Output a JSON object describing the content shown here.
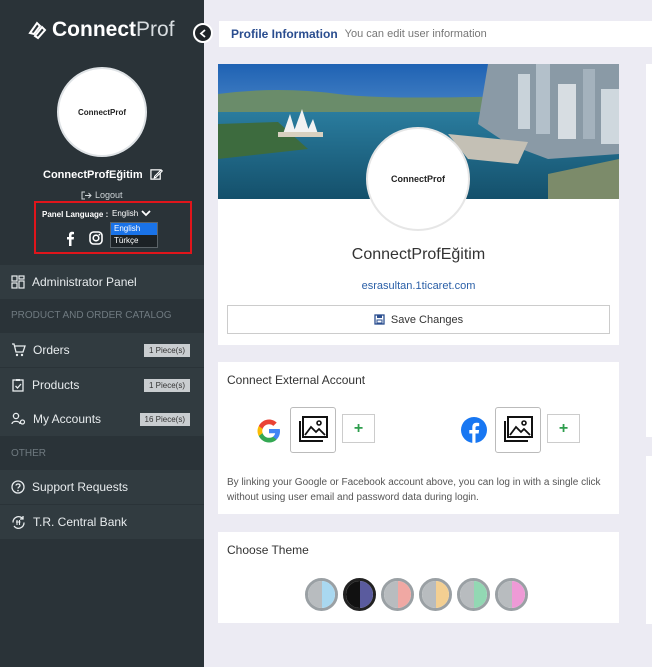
{
  "sidebar": {
    "brand_bold": "Connect",
    "brand_thin": "Prof",
    "avatar_text": "ConnectProf",
    "user_name": "ConnectProfEğitim",
    "logout": "Logout",
    "language_label": "Panel Language :",
    "language_current": "English",
    "language_options": [
      "English",
      "Türkçe"
    ],
    "nav": {
      "admin_panel": "Administrator Panel",
      "section_catalog": "PRODUCT AND ORDER CATALOG",
      "orders": "Orders",
      "orders_badge": "1 Piece(s)",
      "products": "Products",
      "products_badge": "1 Piece(s)",
      "accounts": "My Accounts",
      "accounts_badge": "16 Piece(s)",
      "section_other": "OTHER",
      "support": "Support Requests",
      "central_bank": "T.R. Central Bank"
    }
  },
  "header": {
    "title": "Profile Information",
    "subtitle": "You can edit user information"
  },
  "profile": {
    "avatar_text": "ConnectProf",
    "name": "ConnectProfEğitim",
    "email": "esrasultan.1ticaret.com",
    "save_label": "Save Changes"
  },
  "external": {
    "title": "Connect External Account",
    "description": "By linking your Google or Facebook account above, you can log in with a single click without using user email and password data during login.",
    "plus": "+"
  },
  "theme": {
    "title": "Choose Theme",
    "swatches": [
      {
        "left": "#b8bcbf",
        "right": "#a9d8f0"
      },
      {
        "left": "#111111",
        "right": "#5a5b9e"
      },
      {
        "left": "#b8bcbf",
        "right": "#f0a8a3"
      },
      {
        "left": "#b8bcbf",
        "right": "#f3cf92"
      },
      {
        "left": "#b8bcbf",
        "right": "#92d8b3"
      },
      {
        "left": "#b8bcbf",
        "right": "#ee9ad6"
      }
    ]
  },
  "colors": {
    "sidebar_bg": "#2a3338",
    "accent_blue": "#2a4d8f",
    "page_bg": "#ecebf3",
    "highlight_red": "#e0151b"
  }
}
